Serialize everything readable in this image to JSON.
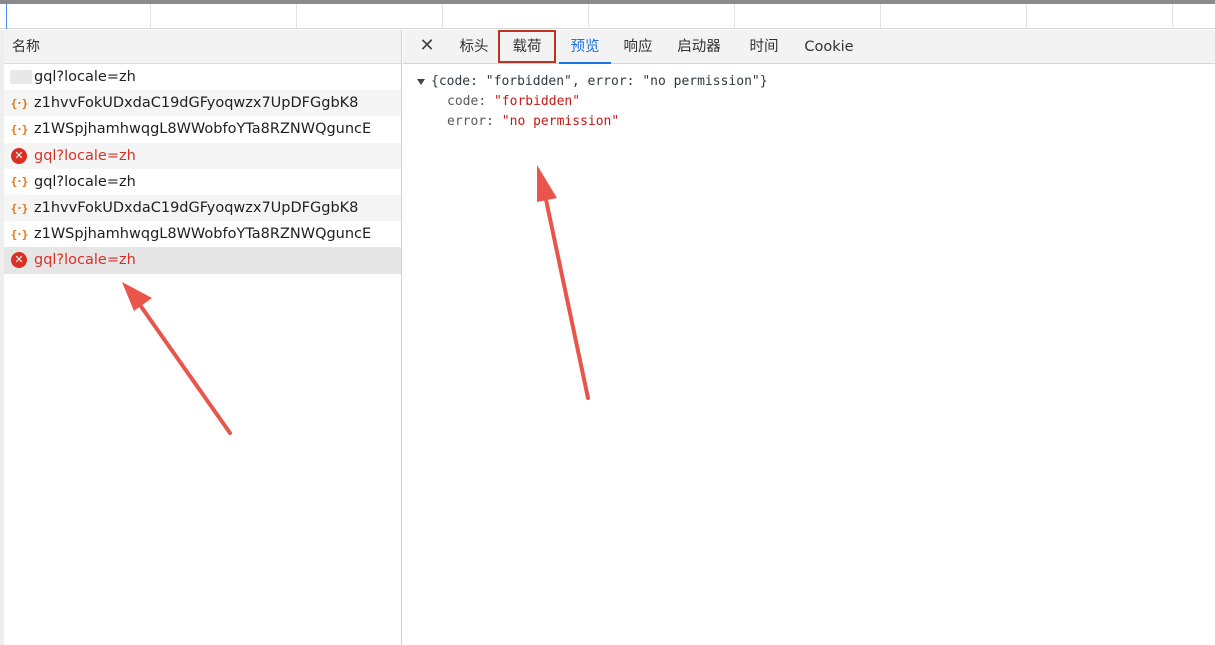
{
  "network_list": {
    "header": "名称",
    "rows": [
      {
        "name": "gql?locale=zh",
        "type": "blurred",
        "status": "ok"
      },
      {
        "name": "z1hvvFokUDxdaC19dGFyoqwzx7UpDFGgbK8",
        "type": "json",
        "status": "ok"
      },
      {
        "name": "z1WSpjhamhwqgL8WWobfoYTa8RZNWQguncE",
        "type": "json",
        "status": "ok"
      },
      {
        "name": "gql?locale=zh",
        "type": "error",
        "status": "error"
      },
      {
        "name": "gql?locale=zh",
        "type": "json",
        "status": "ok"
      },
      {
        "name": "z1hvvFokUDxdaC19dGFyoqwzx7UpDFGgbK8",
        "type": "json",
        "status": "ok"
      },
      {
        "name": "z1WSpjhamhwqgL8WWobfoYTa8RZNWQguncE",
        "type": "json",
        "status": "ok"
      },
      {
        "name": "gql?locale=zh",
        "type": "error",
        "status": "error"
      }
    ]
  },
  "detail_tabs": {
    "close_icon": "close-icon",
    "tabs": [
      "标头",
      "载荷",
      "预览",
      "响应",
      "启动器",
      "时间",
      "Cookie"
    ],
    "active": "预览",
    "highlighted": "载荷"
  },
  "preview": {
    "summary": "{code: \"forbidden\", error: \"no permission\"}",
    "fields": [
      {
        "key": "code",
        "value": "\"forbidden\""
      },
      {
        "key": "error",
        "value": "\"no permission\""
      }
    ]
  },
  "colors": {
    "accent": "#1a73e8",
    "error": "#d93025",
    "annotation": "#e8554a",
    "highlight_box": "#c0341f"
  }
}
